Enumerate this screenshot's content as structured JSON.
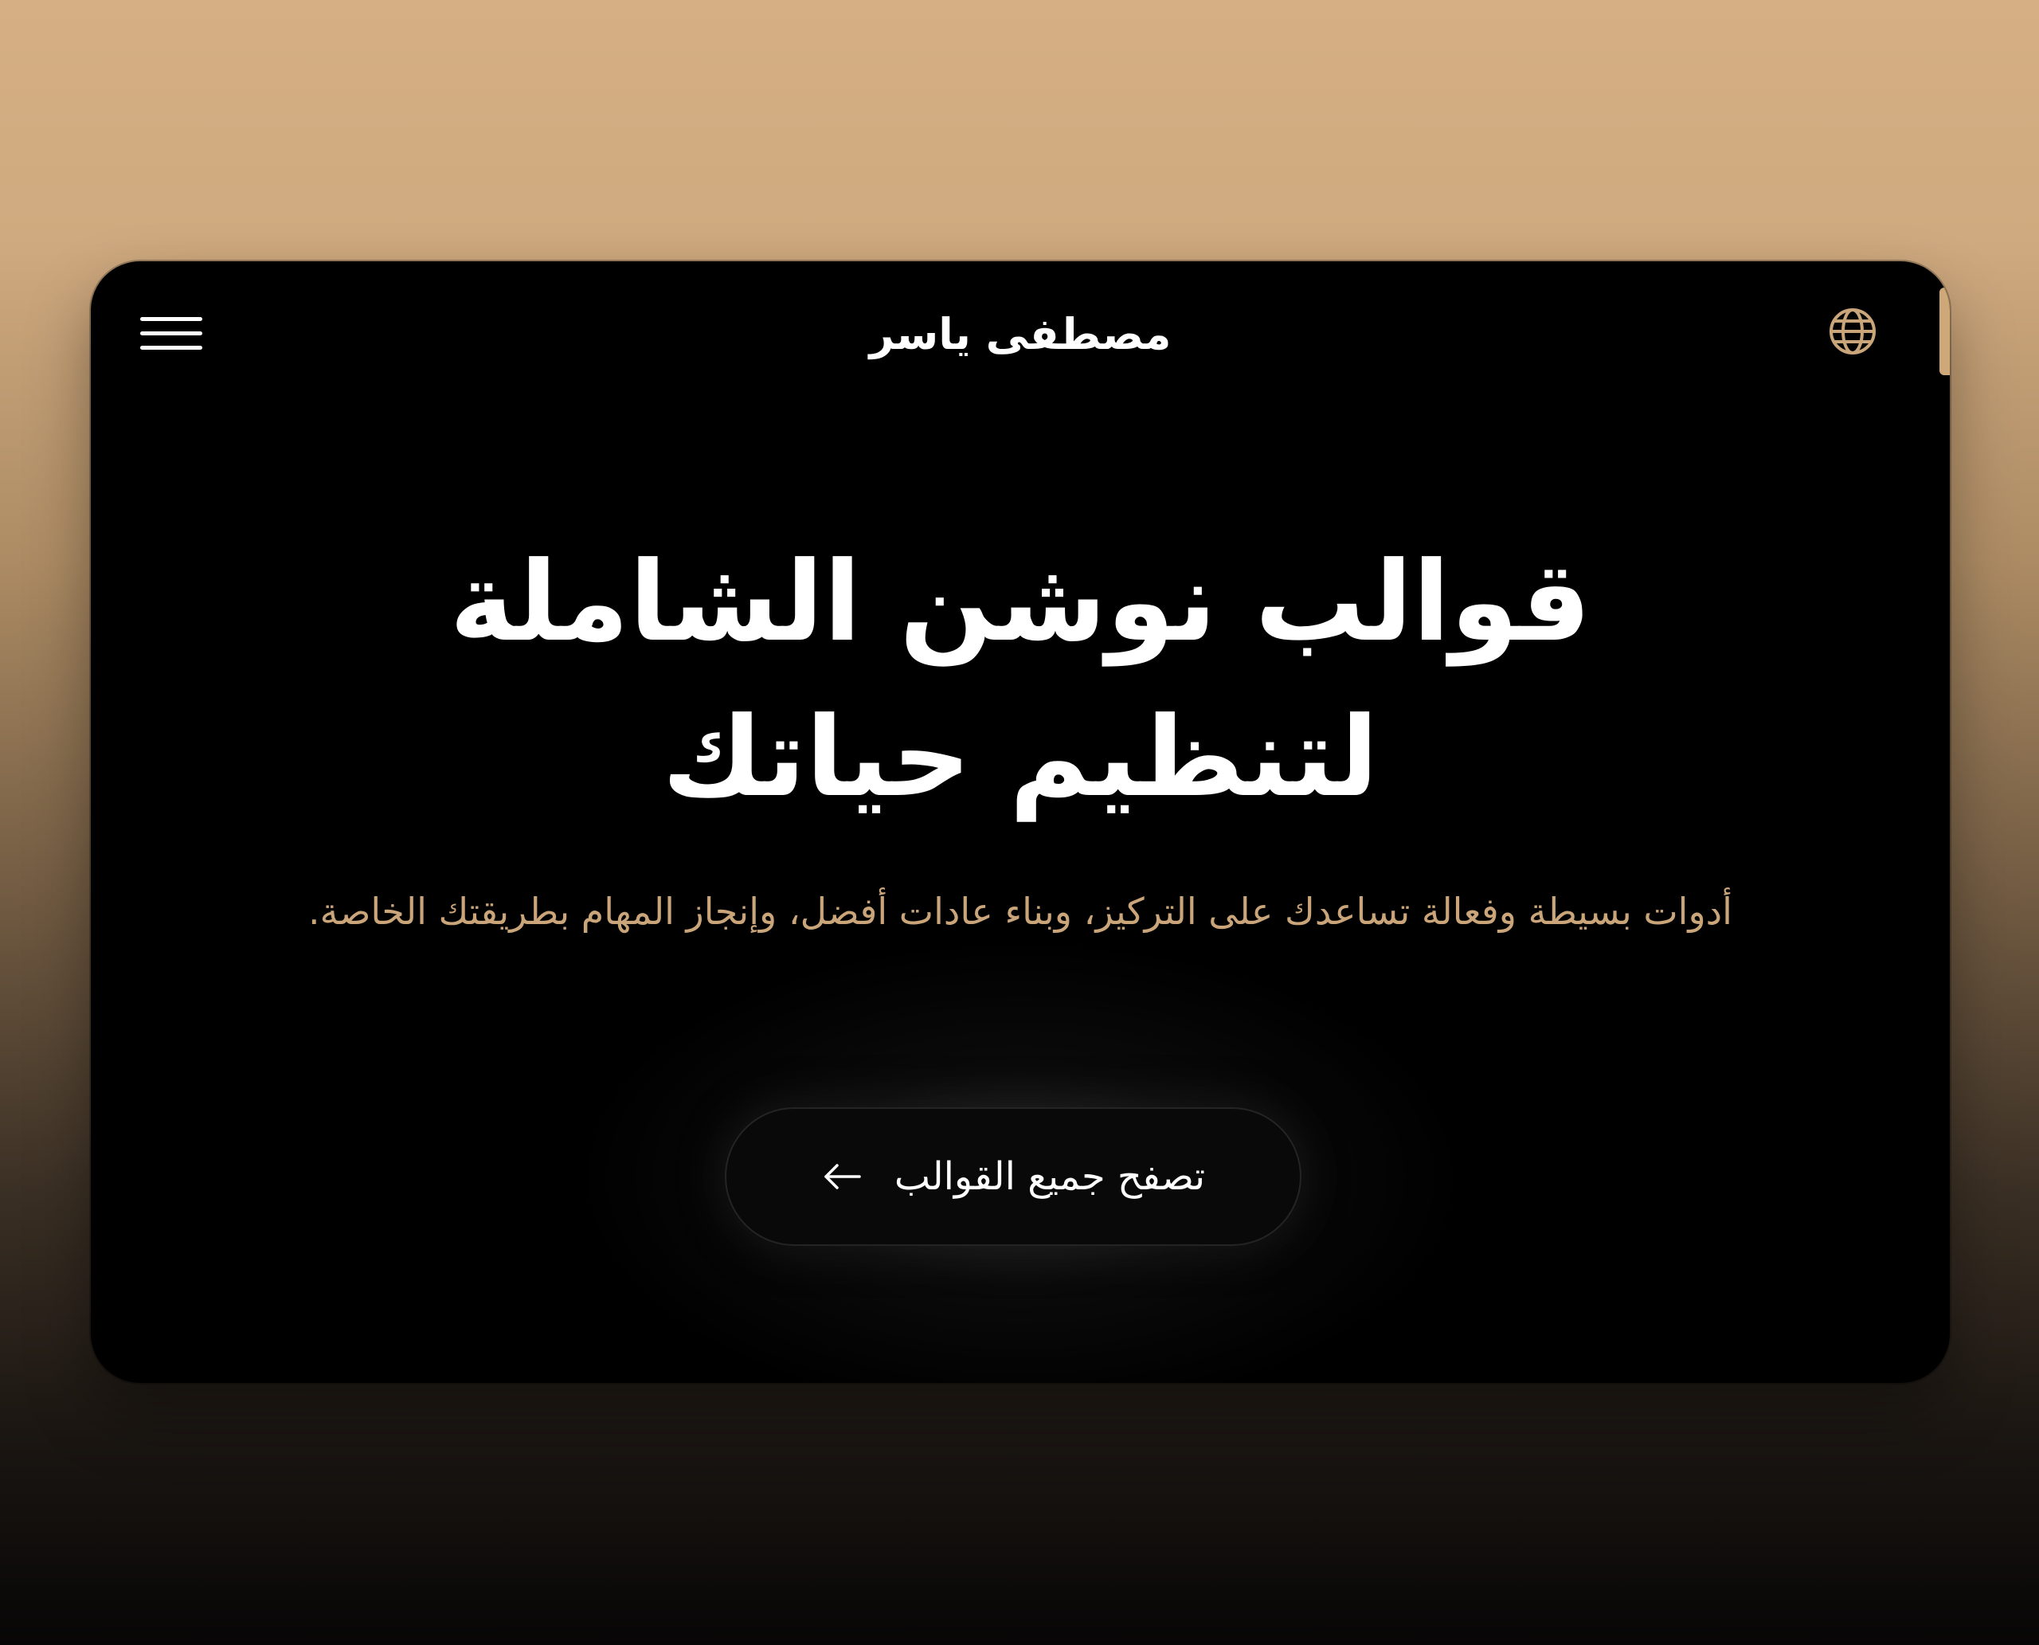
{
  "header": {
    "brand": "مصطفى ياسر",
    "menu_icon": "hamburger-menu-icon",
    "language_icon": "globe-icon"
  },
  "hero": {
    "title_line1": "قوالب نوشن الشاملة",
    "title_line2": "لتنظيم حياتك",
    "subtitle": "أدوات بسيطة وفعالة تساعدك على التركيز، وبناء عادات أفضل، وإنجاز المهام بطريقتك الخاصة."
  },
  "cta": {
    "label": "تصفح جميع القوالب",
    "icon": "arrow-left-icon"
  },
  "colors": {
    "accent": "#cba57a",
    "card_background": "#000000",
    "page_gradient_top": "#d6b084",
    "page_gradient_bottom": "#070606"
  }
}
